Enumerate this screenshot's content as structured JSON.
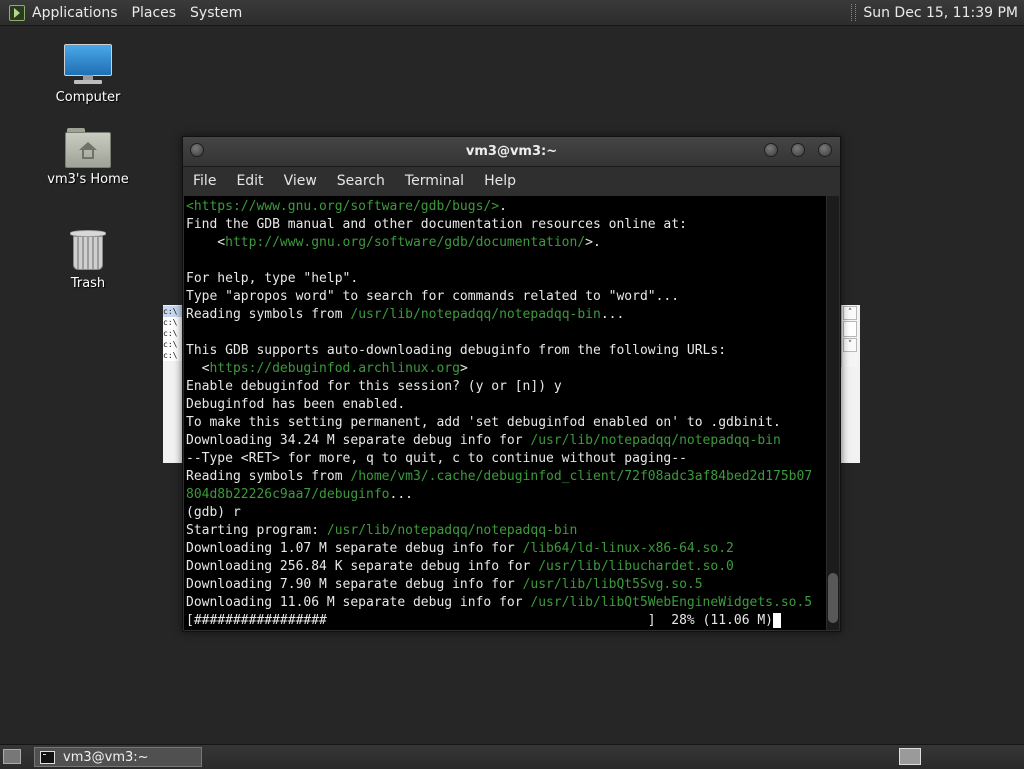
{
  "top_panel": {
    "menus": [
      "Applications",
      "Places",
      "System"
    ],
    "clock": "Sun Dec 15, 11:39 PM"
  },
  "desktop": {
    "icons": [
      {
        "label": "Computer",
        "icon": "computer-icon"
      },
      {
        "label": "vm3's Home",
        "icon": "home-folder-icon"
      },
      {
        "label": "Trash",
        "icon": "trash-icon"
      }
    ]
  },
  "background_window": {
    "lines": [
      "c:\\",
      "c:\\",
      "c:\\",
      "c:\\",
      "c:\\"
    ]
  },
  "terminal": {
    "title": "vm3@vm3:~",
    "menu": [
      "File",
      "Edit",
      "View",
      "Search",
      "Terminal",
      "Help"
    ],
    "lines": [
      [
        {
          "t": "<https://www.gnu.org/software/gdb/bugs/>",
          "link": true
        },
        {
          "t": "."
        }
      ],
      [
        {
          "t": "Find the GDB manual and other documentation resources online at:"
        }
      ],
      [
        {
          "t": "    <"
        },
        {
          "t": "http://www.gnu.org/software/gdb/documentation/",
          "link": true
        },
        {
          "t": ">."
        }
      ],
      [
        {
          "t": ""
        }
      ],
      [
        {
          "t": "For help, type \"help\"."
        }
      ],
      [
        {
          "t": "Type \"apropos word\" to search for commands related to \"word\"..."
        }
      ],
      [
        {
          "t": "Reading symbols from "
        },
        {
          "t": "/usr/lib/notepadqq/notepadqq-bin",
          "link": true
        },
        {
          "t": "..."
        }
      ],
      [
        {
          "t": ""
        }
      ],
      [
        {
          "t": "This GDB supports auto-downloading debuginfo from the following URLs:"
        }
      ],
      [
        {
          "t": "  <"
        },
        {
          "t": "https://debuginfod.archlinux.org",
          "link": true
        },
        {
          "t": ">"
        }
      ],
      [
        {
          "t": "Enable debuginfod for this session? (y or [n]) y"
        }
      ],
      [
        {
          "t": "Debuginfod has been enabled."
        }
      ],
      [
        {
          "t": "To make this setting permanent, add 'set debuginfod enabled on' to .gdbinit."
        }
      ],
      [
        {
          "t": "Downloading 34.24 M separate debug info for "
        },
        {
          "t": "/usr/lib/notepadqq/notepadqq-bin",
          "link": true
        }
      ],
      [
        {
          "t": "--Type <RET> for more, q to quit, c to continue without paging--"
        }
      ],
      [
        {
          "t": "Reading symbols from "
        },
        {
          "t": "/home/vm3/.cache/debuginfod_client/72f08adc3af84bed2d175b07",
          "link": true
        }
      ],
      [
        {
          "t": "804d8b22226c9aa7/debuginfo",
          "link": true
        },
        {
          "t": "..."
        }
      ],
      [
        {
          "t": "(gdb) r"
        }
      ],
      [
        {
          "t": "Starting program: "
        },
        {
          "t": "/usr/lib/notepadqq/notepadqq-bin",
          "link": true
        }
      ],
      [
        {
          "t": "Downloading 1.07 M separate debug info for "
        },
        {
          "t": "/lib64/ld-linux-x86-64.so.2",
          "link": true
        }
      ],
      [
        {
          "t": "Downloading 256.84 K separate debug info for "
        },
        {
          "t": "/usr/lib/libuchardet.so.0",
          "link": true
        }
      ],
      [
        {
          "t": "Downloading 7.90 M separate debug info for "
        },
        {
          "t": "/usr/lib/libQt5Svg.so.5",
          "link": true
        }
      ],
      [
        {
          "t": "Downloading 11.06 M separate debug info for "
        },
        {
          "t": "/usr/lib/libQt5WebEngineWidgets.so.5",
          "link": true
        }
      ],
      [
        {
          "t": "[#################                                         ]  28% (11.06 M)"
        },
        {
          "t": " ",
          "cursor": true
        }
      ]
    ],
    "download_progress_percent": 28,
    "colors": {
      "background": "#000000",
      "text": "#e8e8e8",
      "path": "#3c9a3c"
    }
  },
  "bottom_panel": {
    "task": "vm3@vm3:~"
  }
}
